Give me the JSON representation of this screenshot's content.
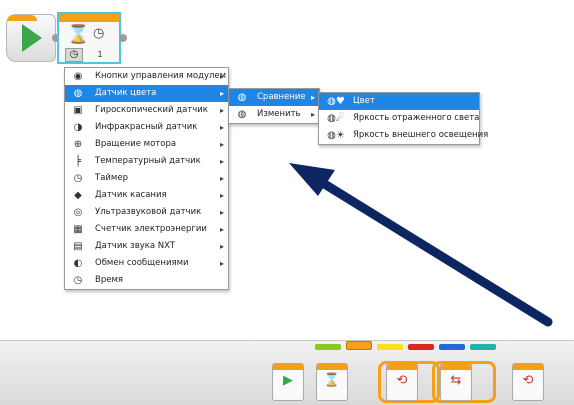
{
  "canvas": {
    "wait_param": "1",
    "hourglass_glyph": "⌛",
    "timer_glyph": "◷",
    "mode_glyph": "◷"
  },
  "menu1": {
    "items": [
      {
        "label": "Кнопки управления модулем",
        "icon": "brick-buttons-icon",
        "glyph": "◉"
      },
      {
        "label": "Датчик цвета",
        "icon": "color-sensor-icon",
        "glyph": "◍"
      },
      {
        "label": "Гироскопический датчик",
        "icon": "gyro-sensor-icon",
        "glyph": "▣"
      },
      {
        "label": "Инфракрасный датчик",
        "icon": "infrared-sensor-icon",
        "glyph": "◑"
      },
      {
        "label": "Вращение мотора",
        "icon": "motor-rotation-icon",
        "glyph": "⊕"
      },
      {
        "label": "Температурный датчик",
        "icon": "temperature-sensor-icon",
        "glyph": "╞"
      },
      {
        "label": "Таймер",
        "icon": "timer-icon",
        "glyph": "◷"
      },
      {
        "label": "Датчик касания",
        "icon": "touch-sensor-icon",
        "glyph": "◆"
      },
      {
        "label": "Ультразвуковой датчик",
        "icon": "ultrasonic-sensor-icon",
        "glyph": "◎"
      },
      {
        "label": "Счетчик электроэнергии",
        "icon": "energy-meter-icon",
        "glyph": "▦"
      },
      {
        "label": "Датчик звука NXT",
        "icon": "sound-sensor-icon",
        "glyph": "▤"
      },
      {
        "label": "Обмен сообщениями",
        "icon": "messaging-icon",
        "glyph": "◐"
      },
      {
        "label": "Время",
        "icon": "time-icon",
        "glyph": "◷"
      }
    ]
  },
  "menu2": {
    "items": [
      {
        "label": "Сравнение",
        "icon": "compare-icon",
        "glyph": "◍"
      },
      {
        "label": "Изменить",
        "icon": "change-icon",
        "glyph": "◍"
      }
    ]
  },
  "menu3": {
    "items": [
      {
        "label": "Цвет",
        "icon": "color-icon",
        "glyph": "◍♥"
      },
      {
        "label": "Яркость отраженного света",
        "icon": "reflected-light-icon",
        "glyph": "◍☄"
      },
      {
        "label": "Яркость внешнего освещения",
        "icon": "ambient-light-icon",
        "glyph": "◍☀"
      }
    ]
  },
  "colors": {
    "accent": "#1d86e6",
    "block_orange": "#f6a01a",
    "selection_cyan": "#49c6e6",
    "arrow_navy": "#0d2560"
  },
  "palette": {
    "tabs": [
      {
        "name": "action",
        "color": "#8fc81e"
      },
      {
        "name": "flow",
        "color": "#f6a01a"
      },
      {
        "name": "sensor",
        "color": "#f7e11a"
      },
      {
        "name": "data",
        "color": "#d8281e"
      },
      {
        "name": "advanced",
        "color": "#1d6cd8"
      },
      {
        "name": "myblocks",
        "color": "#21b3a4"
      }
    ],
    "blocks": [
      {
        "name": "start-block-icon",
        "glyph": "▶"
      },
      {
        "name": "wait-block-icon",
        "glyph": "⌛"
      },
      {
        "name": "loop-block-icon",
        "glyph": "⟲"
      },
      {
        "name": "switch-block-icon",
        "glyph": "⇆"
      },
      {
        "name": "loop-interrupt-block-icon",
        "glyph": "⟲"
      }
    ]
  }
}
